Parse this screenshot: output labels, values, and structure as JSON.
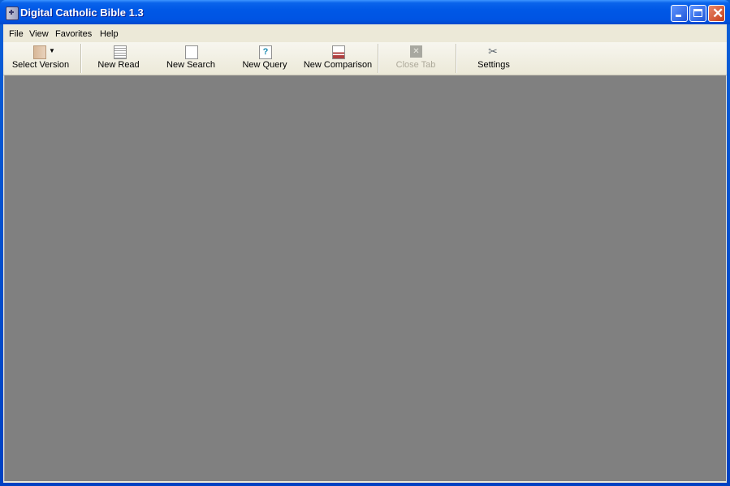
{
  "window": {
    "title": "Digital Catholic Bible 1.3",
    "controls": {
      "minimize": "minimize",
      "maximize": "maximize",
      "close": "close"
    }
  },
  "menubar": {
    "items": [
      {
        "label": "File"
      },
      {
        "label": "View"
      },
      {
        "label": "Favorites"
      },
      {
        "label": "Help"
      }
    ]
  },
  "toolbar": {
    "select_version": {
      "label": "Select Version",
      "icon": "book-icon",
      "enabled": true
    },
    "new_read": {
      "label": "New Read",
      "icon": "document-icon",
      "enabled": true
    },
    "new_search": {
      "label": "New Search",
      "icon": "magnifier-icon",
      "enabled": true
    },
    "new_query": {
      "label": "New Query",
      "icon": "question-icon",
      "enabled": true
    },
    "new_comparison": {
      "label": "New Comparison",
      "icon": "compare-icon",
      "enabled": true
    },
    "close_tab": {
      "label": "Close Tab",
      "icon": "close-icon",
      "enabled": false
    },
    "settings": {
      "label": "Settings",
      "icon": "tools-icon",
      "enabled": true
    }
  },
  "colors": {
    "workspace": "#808080",
    "chrome": "#ece9d8",
    "titlebar": "#0054e3"
  }
}
